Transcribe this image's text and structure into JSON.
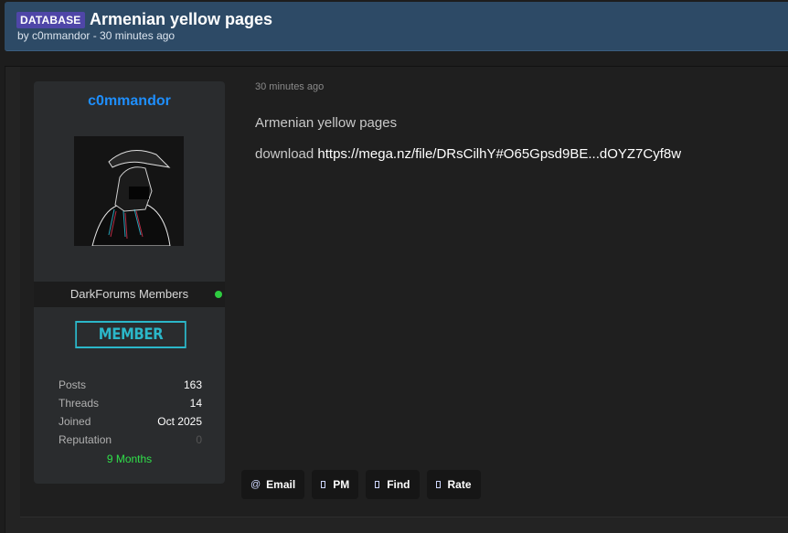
{
  "thread": {
    "prefix": "DATABASE",
    "title": "Armenian yellow pages",
    "meta": "by c0mmandor - 30 minutes ago"
  },
  "author": {
    "name": "c0mmandor",
    "usergroup": "DarkForums Members",
    "online": true,
    "rank": "MEMBER",
    "stats": [
      {
        "label": "Posts",
        "value": "163"
      },
      {
        "label": "Threads",
        "value": "14"
      },
      {
        "label": "Joined",
        "value": "Oct 2025"
      },
      {
        "label": "Reputation",
        "value": "0"
      }
    ],
    "duration": "9 Months"
  },
  "post": {
    "date": "30 minutes ago",
    "line1": "Armenian yellow pages",
    "download_label": "download",
    "link_text": "https://mega.nz/file/DRsCilhY#O65Gpsd9BE...dOYZ7Cyf8w"
  },
  "actions": [
    {
      "label": "Email",
      "icon": "at-icon"
    },
    {
      "label": "PM",
      "icon": "message-icon"
    },
    {
      "label": "Find",
      "icon": "search-icon"
    },
    {
      "label": "Rate",
      "icon": "star-icon"
    }
  ],
  "colors": {
    "header_bg": "#2d4a66",
    "prefix_bg": "#4f46a8",
    "username": "#1e8fff",
    "rank_accent": "#2bb7c9",
    "online": "#2ecc40",
    "duration": "#30e04a"
  }
}
